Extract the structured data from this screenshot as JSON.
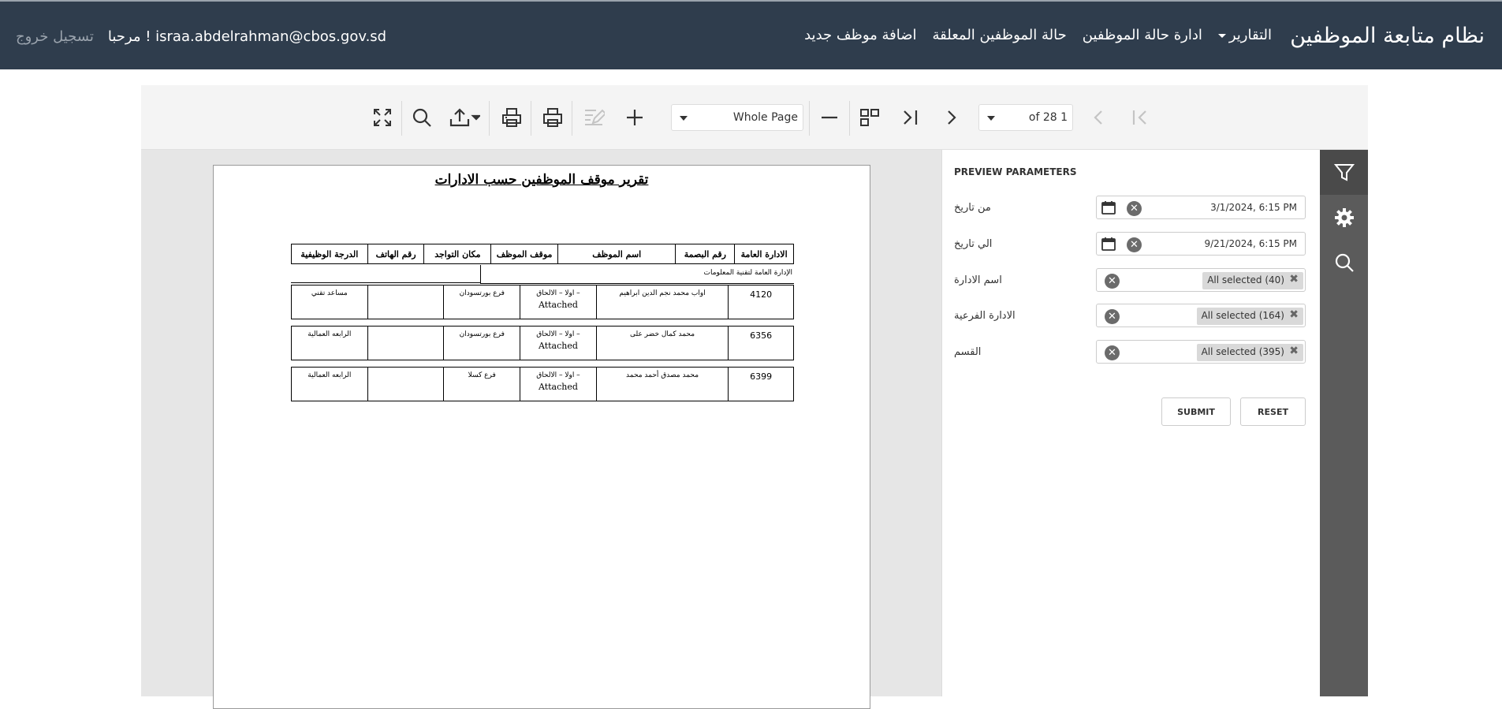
{
  "nav": {
    "brand": "نظام متابعة الموظفين",
    "links": [
      "اضافة موظف جديد",
      "حالة الموظفين المعلقة",
      "ادارة حالة الموظفين",
      "التقارير"
    ],
    "welcome": "مرحبا ! israa.abdelrahman@cbos.gov.sd",
    "logout": "تسجيل خروج"
  },
  "toolbar": {
    "zoom_value": "Whole Page",
    "page_value": "of 28 1",
    "icons": [
      "fullscreen-icon",
      "search-icon",
      "export-icon",
      "print-page-icon",
      "print-icon",
      "edit-icon",
      "zoom-in-icon",
      "zoom-out-icon",
      "multipage-icon",
      "last-page-icon",
      "next-page-icon",
      "previous-page-icon",
      "first-page-icon"
    ]
  },
  "report": {
    "title": "تقرير موقف الموظفين حسب الادارات",
    "columns": [
      "الادارة العامة",
      "رقم البصمة",
      "اسم الموظف",
      "موقف الموظف",
      "مكان التواجد",
      "رقم الهاتف",
      "الدرجة الوظيفية"
    ],
    "group": "الإدارة العامة لتقنية المعلومات",
    "rows": [
      {
        "id": "4120",
        "name": "اواب محمد نجم الدين ابراهيم",
        "status": "– اولا – الالحاق",
        "status_en": "Attached",
        "location": "فرع بورتسودان",
        "phone": "",
        "grade": "مساعد تقني"
      },
      {
        "id": "6356",
        "name": "محمد كمال خضر على",
        "status": "– اولا – الالحاق",
        "status_en": "Attached",
        "location": "فرع بورتسودان",
        "phone": "",
        "grade": "الرابعه العمالية"
      },
      {
        "id": "6399",
        "name": "محمد مصدق أحمد محمد",
        "status": "– اولا – الالحاق",
        "status_en": "Attached",
        "location": "فرع كسلا",
        "phone": "",
        "grade": "الرابعه العمالية"
      }
    ]
  },
  "params": {
    "title": "PREVIEW PARAMETERS",
    "from_label": "من تاريخ",
    "from_value": "3/1/2024, 6:15 PM",
    "to_label": "الي تاريخ",
    "to_value": "9/21/2024, 6:15 PM",
    "dept_label": "اسم الادارة",
    "dept_value": "All selected (40)",
    "subdept_label": "الادارة الفرعية",
    "subdept_value": "All selected (164)",
    "section_label": "القسم",
    "section_value": "All selected (395)",
    "submit": "SUBMIT",
    "reset": "RESET"
  },
  "tabs": [
    "filter-icon",
    "settings-icon",
    "search-icon"
  ]
}
